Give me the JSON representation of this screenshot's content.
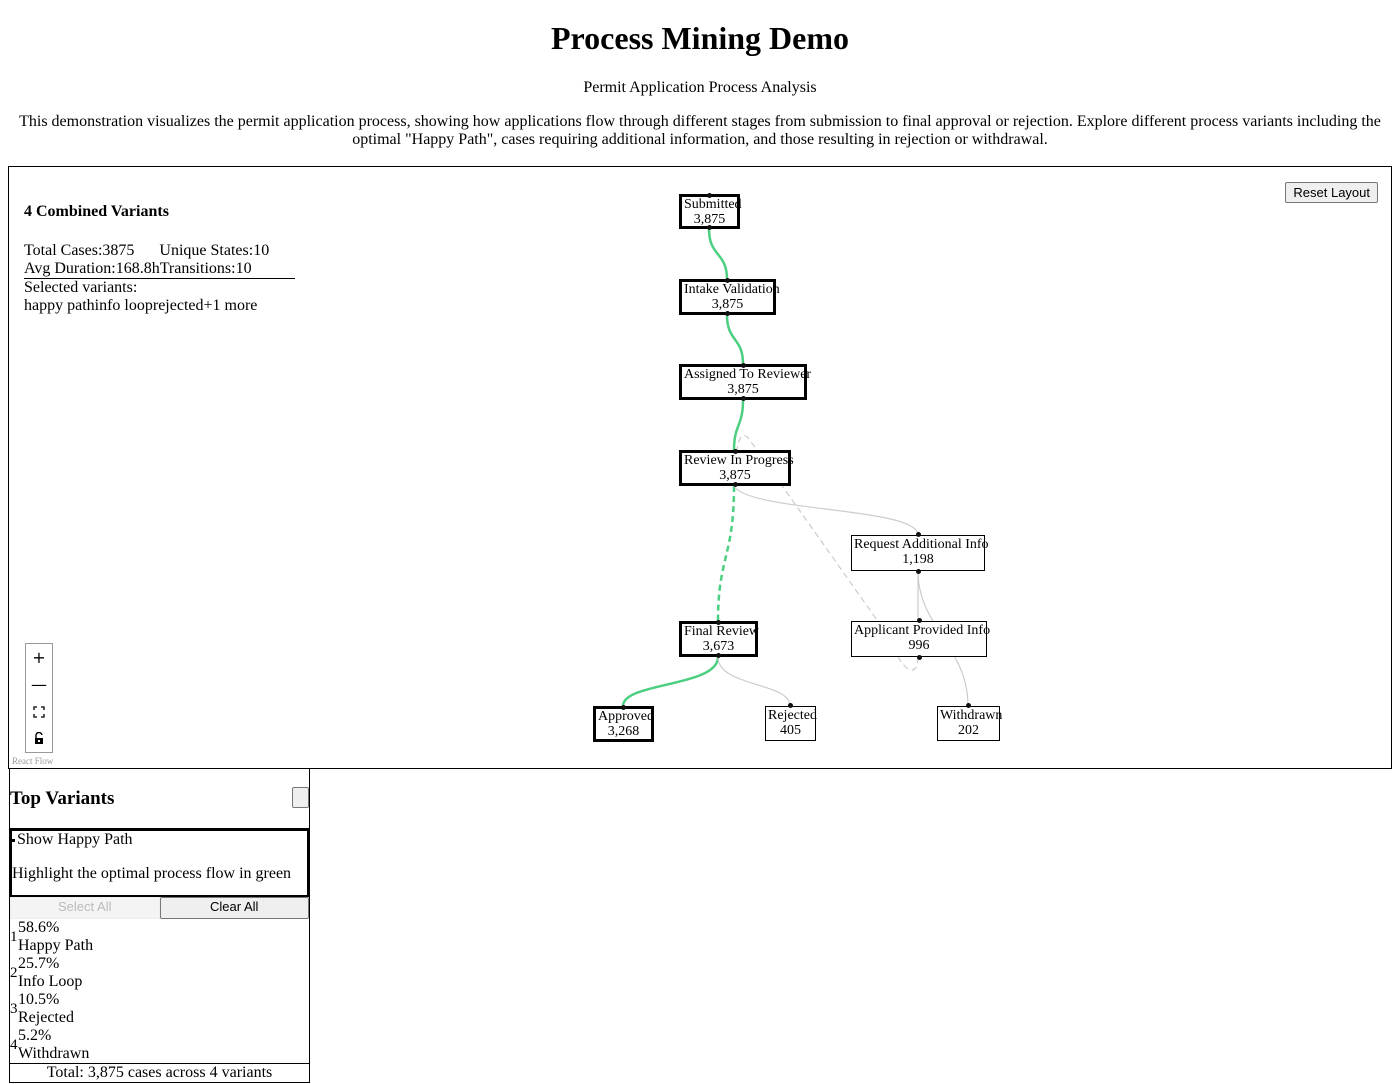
{
  "header": {
    "title": "Process Mining Demo",
    "subtitle": "Permit Application Process Analysis",
    "description": "This demonstration visualizes the permit application process, showing how applications flow through different stages from submission to final approval or rejection. Explore different process variants including the optimal \"Happy Path\", cases requiring additional information, and those resulting in rejection or withdrawal."
  },
  "stats": {
    "title": "4 Combined Variants",
    "total_cases_label": "Total Cases:",
    "total_cases": "3875",
    "unique_states_label": "Unique States:",
    "unique_states": "10",
    "avg_duration_label": "Avg Duration:",
    "avg_duration": "168.8h",
    "transitions_label": "Transitions:",
    "transitions": "10",
    "selected_label": "Selected variants:",
    "selected": [
      "happy path",
      "info loop",
      "rejected"
    ],
    "more": "+1 more"
  },
  "toolbar": {
    "reset_label": "Reset Layout"
  },
  "nodes": {
    "submitted": {
      "label": "Submitted",
      "count": "3,875"
    },
    "intake": {
      "label": "Intake Validation",
      "count": "3,875"
    },
    "assigned": {
      "label": "Assigned To Reviewer",
      "count": "3,875"
    },
    "review": {
      "label": "Review In Progress",
      "count": "3,875"
    },
    "request_info": {
      "label": "Request Additional Info",
      "count": "1,198"
    },
    "provided_info": {
      "label": "Applicant Provided Info",
      "count": "996"
    },
    "final_review": {
      "label": "Final Review",
      "count": "3,673"
    },
    "approved": {
      "label": "Approved",
      "count": "3,268"
    },
    "rejected": {
      "label": "Rejected",
      "count": "405"
    },
    "withdrawn": {
      "label": "Withdrawn",
      "count": "202"
    }
  },
  "controls": {
    "zoom_in": "+",
    "zoom_out": "—",
    "fit": "⛶",
    "lock": "🔓",
    "icons": [
      "zoom-in-icon",
      "zoom-out-icon",
      "fit-view-icon",
      "lock-icon"
    ]
  },
  "attribution": "React Flow",
  "colors": {
    "happy_path": "#4bcf80",
    "edge": "#cccccc",
    "border": "#000000"
  },
  "variants_panel": {
    "title": "Top Variants",
    "happy_path_toggle": "Show Happy Path",
    "happy_path_desc": "Highlight the optimal process flow in green",
    "select_all": "Select All",
    "clear_all": "Clear All",
    "items": [
      {
        "rank": "1",
        "pct": "58.6%",
        "name": "Happy Path"
      },
      {
        "rank": "2",
        "pct": "25.7%",
        "name": "Info Loop"
      },
      {
        "rank": "3",
        "pct": "10.5%",
        "name": "Rejected"
      },
      {
        "rank": "4",
        "pct": "5.2%",
        "name": "Withdrawn"
      }
    ],
    "total": "Total: 3,875 cases across 4 variants"
  }
}
